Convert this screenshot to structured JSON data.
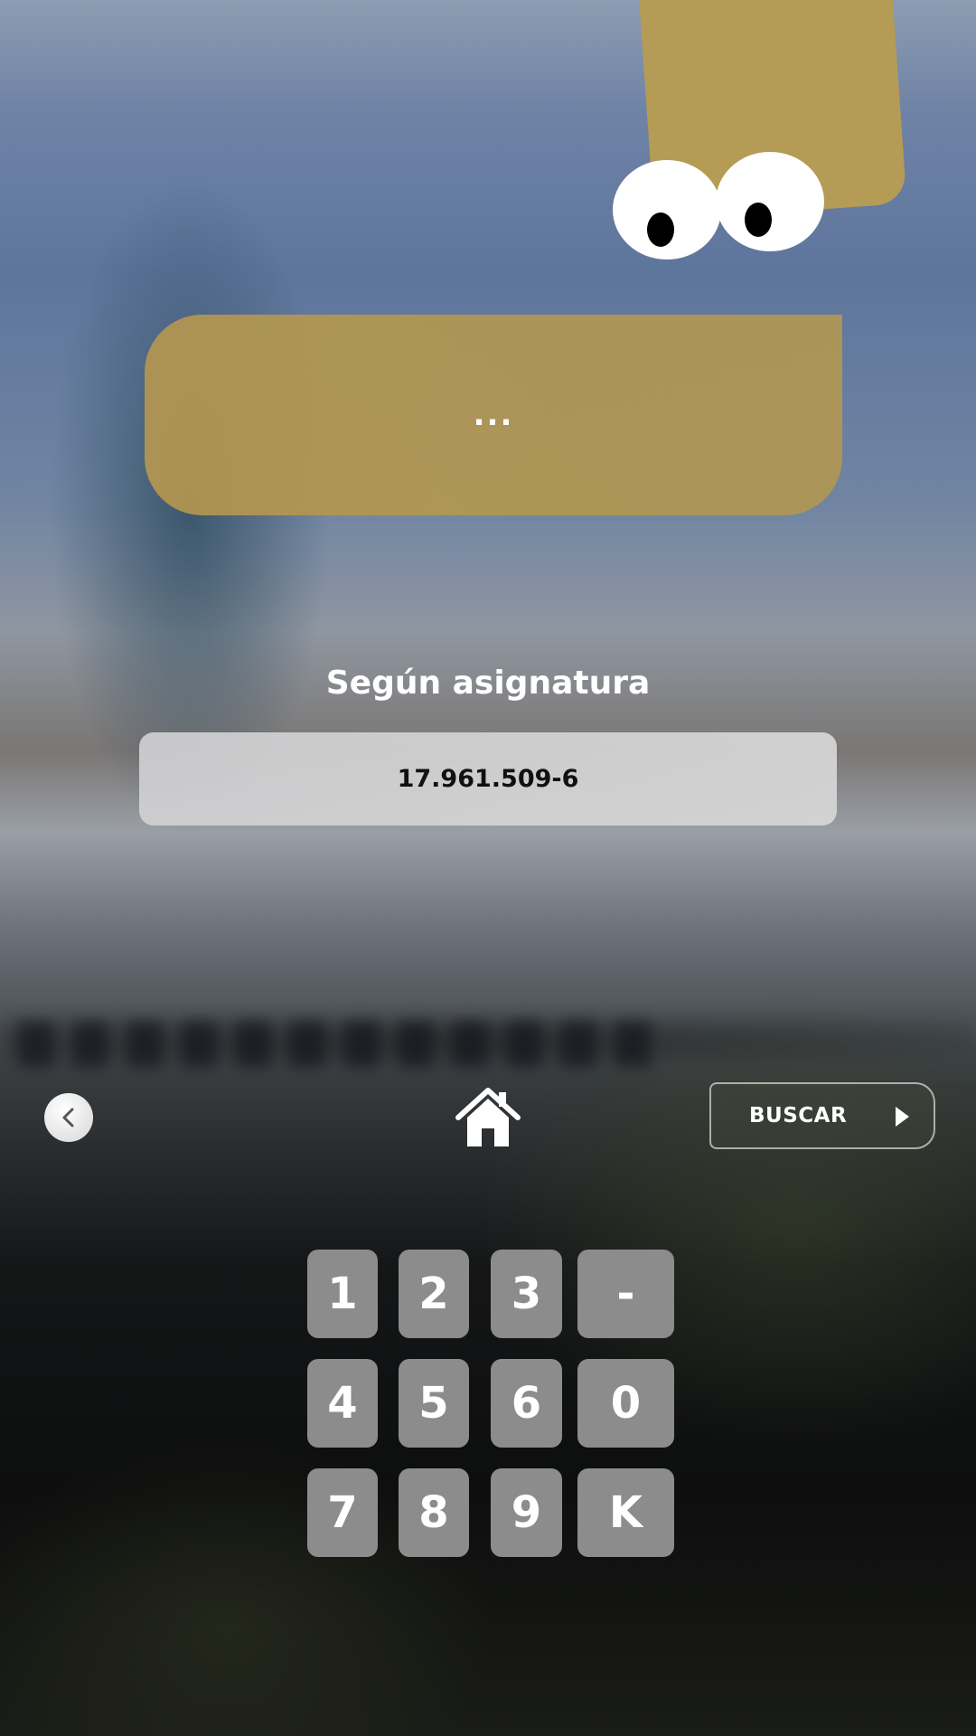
{
  "bubble": {
    "text": "..."
  },
  "section": {
    "title": "Según asignatura"
  },
  "rut_field": {
    "value": "17.961.509-6"
  },
  "nav": {
    "back_icon": "chevron-left-icon",
    "home_icon": "home-icon",
    "search_label": "BUSCAR",
    "search_arrow_icon": "play-arrow-icon"
  },
  "keypad": {
    "keys": [
      "1",
      "2",
      "3",
      "-",
      "4",
      "5",
      "6",
      "0",
      "7",
      "8",
      "9",
      "K"
    ]
  },
  "colors": {
    "mascot": "#b49b56",
    "bubble": "#b49650",
    "key": "#8c8c8c",
    "field": "#d2d2d4"
  }
}
